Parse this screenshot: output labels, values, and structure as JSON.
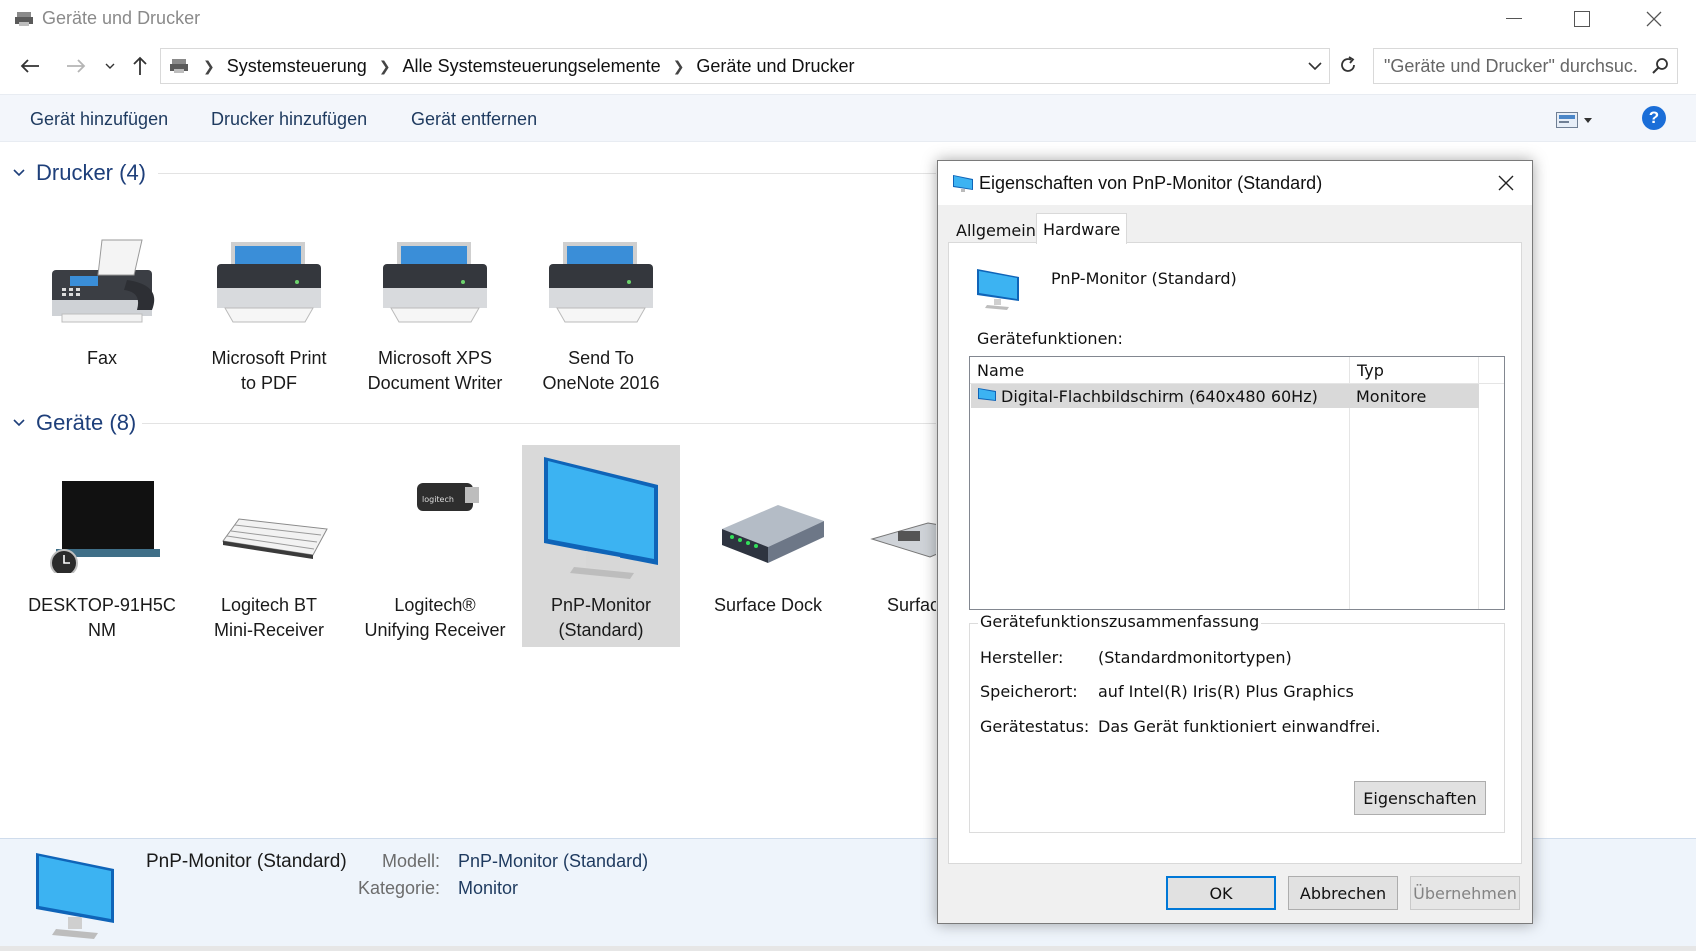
{
  "window": {
    "title": "Geräte und Drucker"
  },
  "address": {
    "crumbs": [
      "Systemsteuerung",
      "Alle Systemsteuerungselemente",
      "Geräte und Drucker"
    ],
    "search_placeholder": "\"Geräte und Drucker\" durchsuc..."
  },
  "commands": {
    "add_device": "Gerät hinzufügen",
    "add_printer": "Drucker hinzufügen",
    "remove_device": "Gerät entfernen",
    "help": "?"
  },
  "groups": {
    "printers": {
      "title": "Drucker (4)",
      "items": [
        {
          "label": "Fax"
        },
        {
          "label": "Microsoft Print\nto PDF"
        },
        {
          "label": "Microsoft XPS\nDocument Writer"
        },
        {
          "label": "Send To\nOneNote 2016"
        }
      ]
    },
    "devices": {
      "title": "Geräte (8)",
      "items": [
        {
          "label": "DESKTOP-91H5C\nNM"
        },
        {
          "label": "Logitech BT\nMini-Receiver"
        },
        {
          "label": "Logitech®\nUnifying Receiver"
        },
        {
          "label": "PnP-Monitor\n(Standard)"
        },
        {
          "label": "Surface Dock"
        },
        {
          "label": "Surfac"
        }
      ]
    }
  },
  "details": {
    "name": "PnP-Monitor (Standard)",
    "model_key": "Modell:",
    "model_value": "PnP-Monitor (Standard)",
    "category_key": "Kategorie:",
    "category_value": "Monitor"
  },
  "dialog": {
    "title": "Eigenschaften von PnP-Monitor (Standard)",
    "tabs": [
      "Allgemein",
      "Hardware"
    ],
    "active_tab": "Hardware",
    "device_name": "PnP-Monitor (Standard)",
    "functions_label": "Gerätefunktionen:",
    "columns": [
      "Name",
      "Typ"
    ],
    "rows": [
      {
        "name": "Digital-Flachbildschirm (640x480 60Hz)",
        "type": "Monitore"
      }
    ],
    "summary_title": "Gerätefunktionszusammenfassung",
    "summary": [
      {
        "key": "Hersteller:",
        "value": "(Standardmonitortypen)"
      },
      {
        "key": "Speicherort:",
        "value": "auf Intel(R) Iris(R) Plus Graphics"
      },
      {
        "key": "Gerätestatus:",
        "value": "Das Gerät funktioniert einwandfrei."
      }
    ],
    "properties_button": "Eigenschaften",
    "ok": "OK",
    "cancel": "Abbrechen",
    "apply": "Übernehmen"
  },
  "colors": {
    "accent": "#0078d7",
    "group_title": "#1e3f7a",
    "selection": "#d9d9d9",
    "details_bg": "#eef4fb"
  }
}
